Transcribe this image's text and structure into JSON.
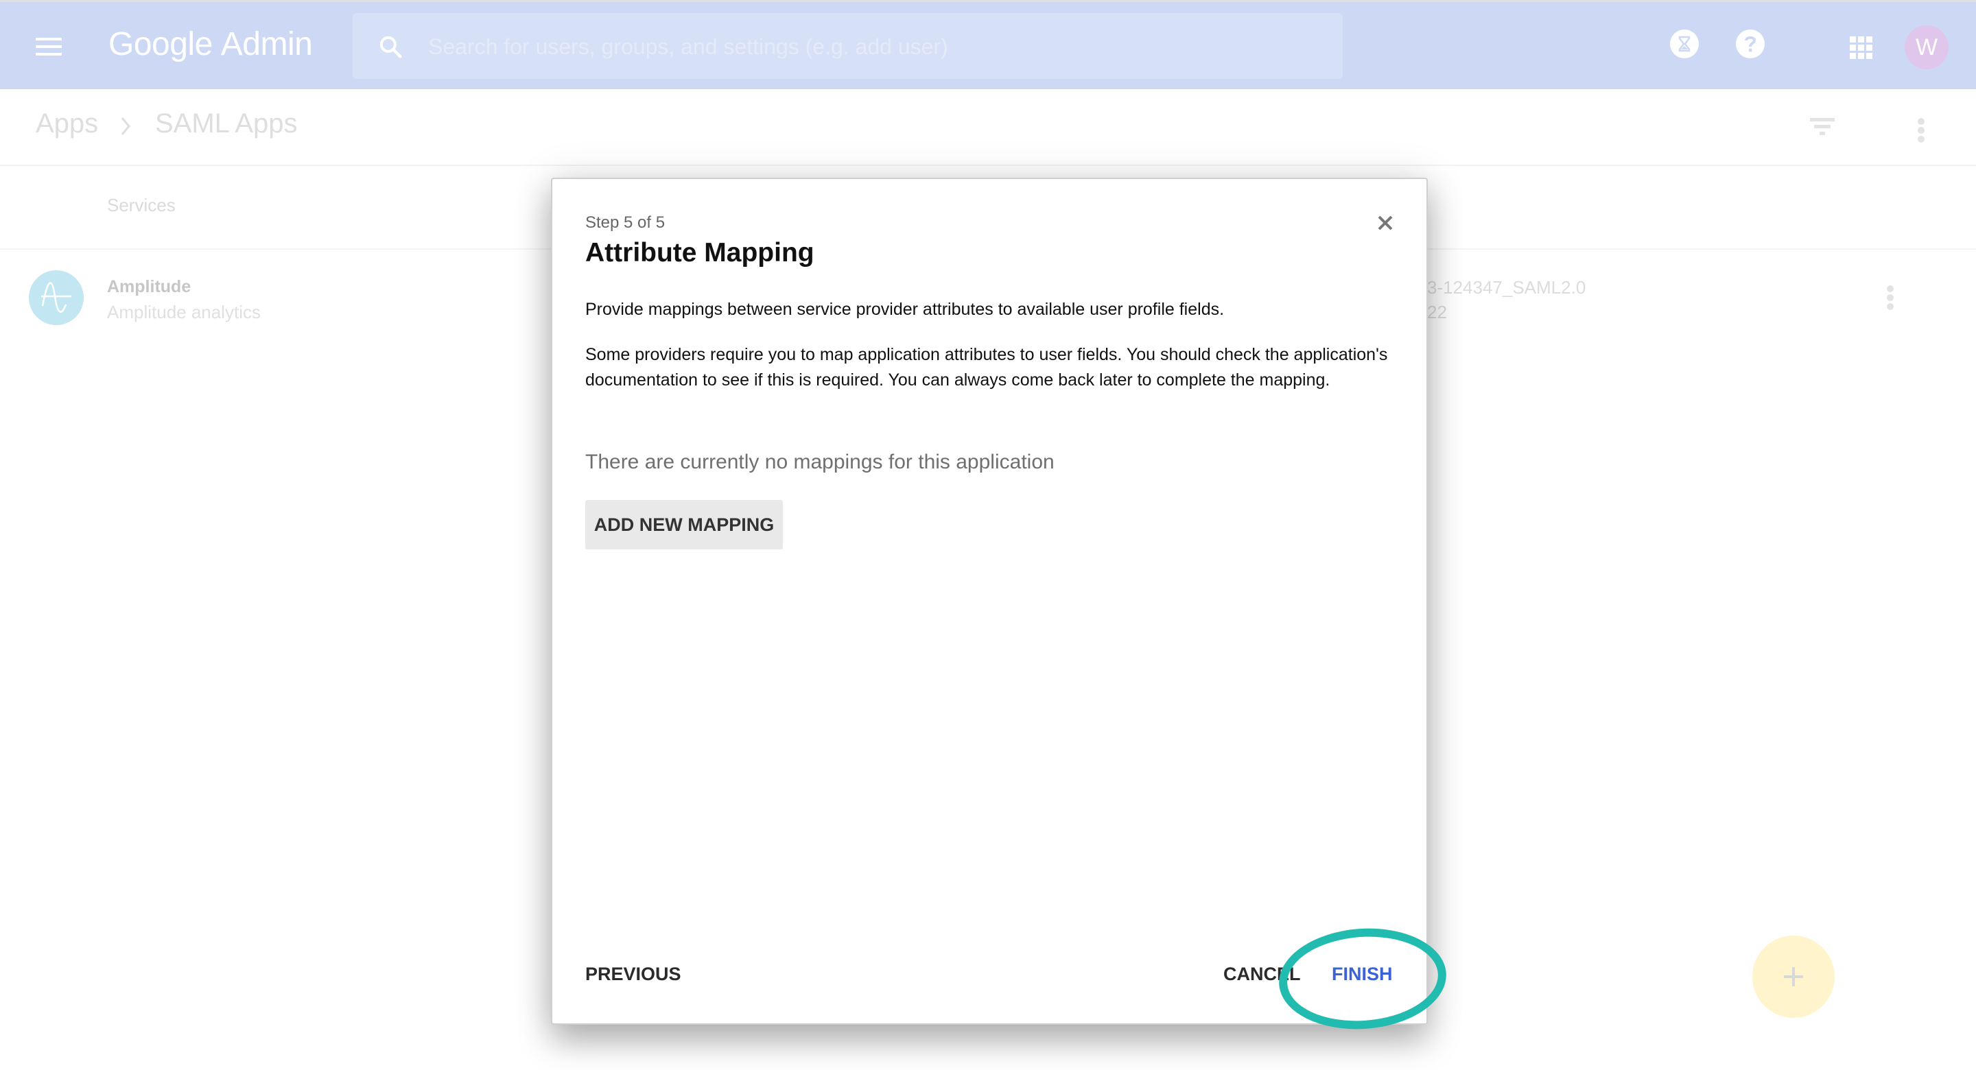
{
  "header": {
    "brand_google": "Google",
    "brand_admin": "Admin",
    "search_placeholder": "Search for users, groups, and settings (e.g. add user)",
    "avatar_initial": "W",
    "colors": {
      "bar": "#cdd9f4",
      "avatar": "#dfc6ea"
    }
  },
  "breadcrumb": {
    "items": [
      "Apps",
      "SAML Apps"
    ]
  },
  "table": {
    "column_header": "Services",
    "rows": [
      {
        "name": "Amplitude",
        "description": "Amplitude analytics",
        "id_line1": "3-124347_SAML2.0",
        "id_line2": "22"
      }
    ]
  },
  "dialog": {
    "step": "Step 5 of 5",
    "title": "Attribute Mapping",
    "paragraph1": "Provide mappings between service provider attributes to available user profile fields.",
    "paragraph2": "Some providers require you to map application attributes to user fields. You should check the application's documentation to see if this is required. You can always come back later to complete the mapping.",
    "empty_state": "There are currently no mappings for this application",
    "add_button": "ADD NEW MAPPING",
    "previous_button": "PREVIOUS",
    "cancel_button": "CANCEL",
    "finish_button": "FINISH",
    "colors": {
      "finish": "#3b63d6",
      "highlight": "#22bbb0"
    }
  },
  "fab": {
    "icon": "plus-icon",
    "color": "#fff4cc"
  }
}
